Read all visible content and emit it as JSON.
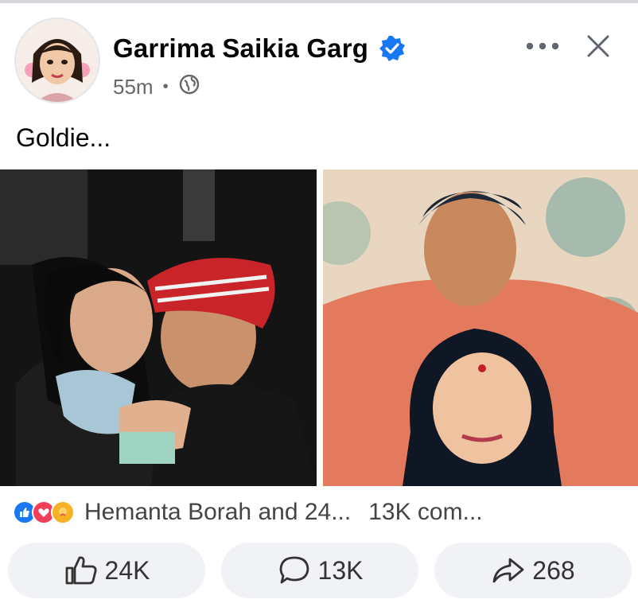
{
  "post": {
    "author": "Garrima Saikia Garg",
    "time": "55m",
    "separator": "•",
    "text": "Goldie...",
    "verified_icon": "verified-badge-icon",
    "privacy_icon": "globe-icon"
  },
  "reactions": {
    "icons": [
      "like-icon",
      "love-icon",
      "care-icon"
    ],
    "names": "Hemanta Borah and 24...",
    "comments": "13K com..."
  },
  "actions": {
    "like_count": "24K",
    "comment_count": "13K",
    "share_count": "268"
  },
  "colors": {
    "like_blue": "#1877f2",
    "love_red": "#f33e58",
    "care_yellow": "#f7b125",
    "muted_text": "#65676b",
    "button_bg": "#f0f2f5"
  }
}
